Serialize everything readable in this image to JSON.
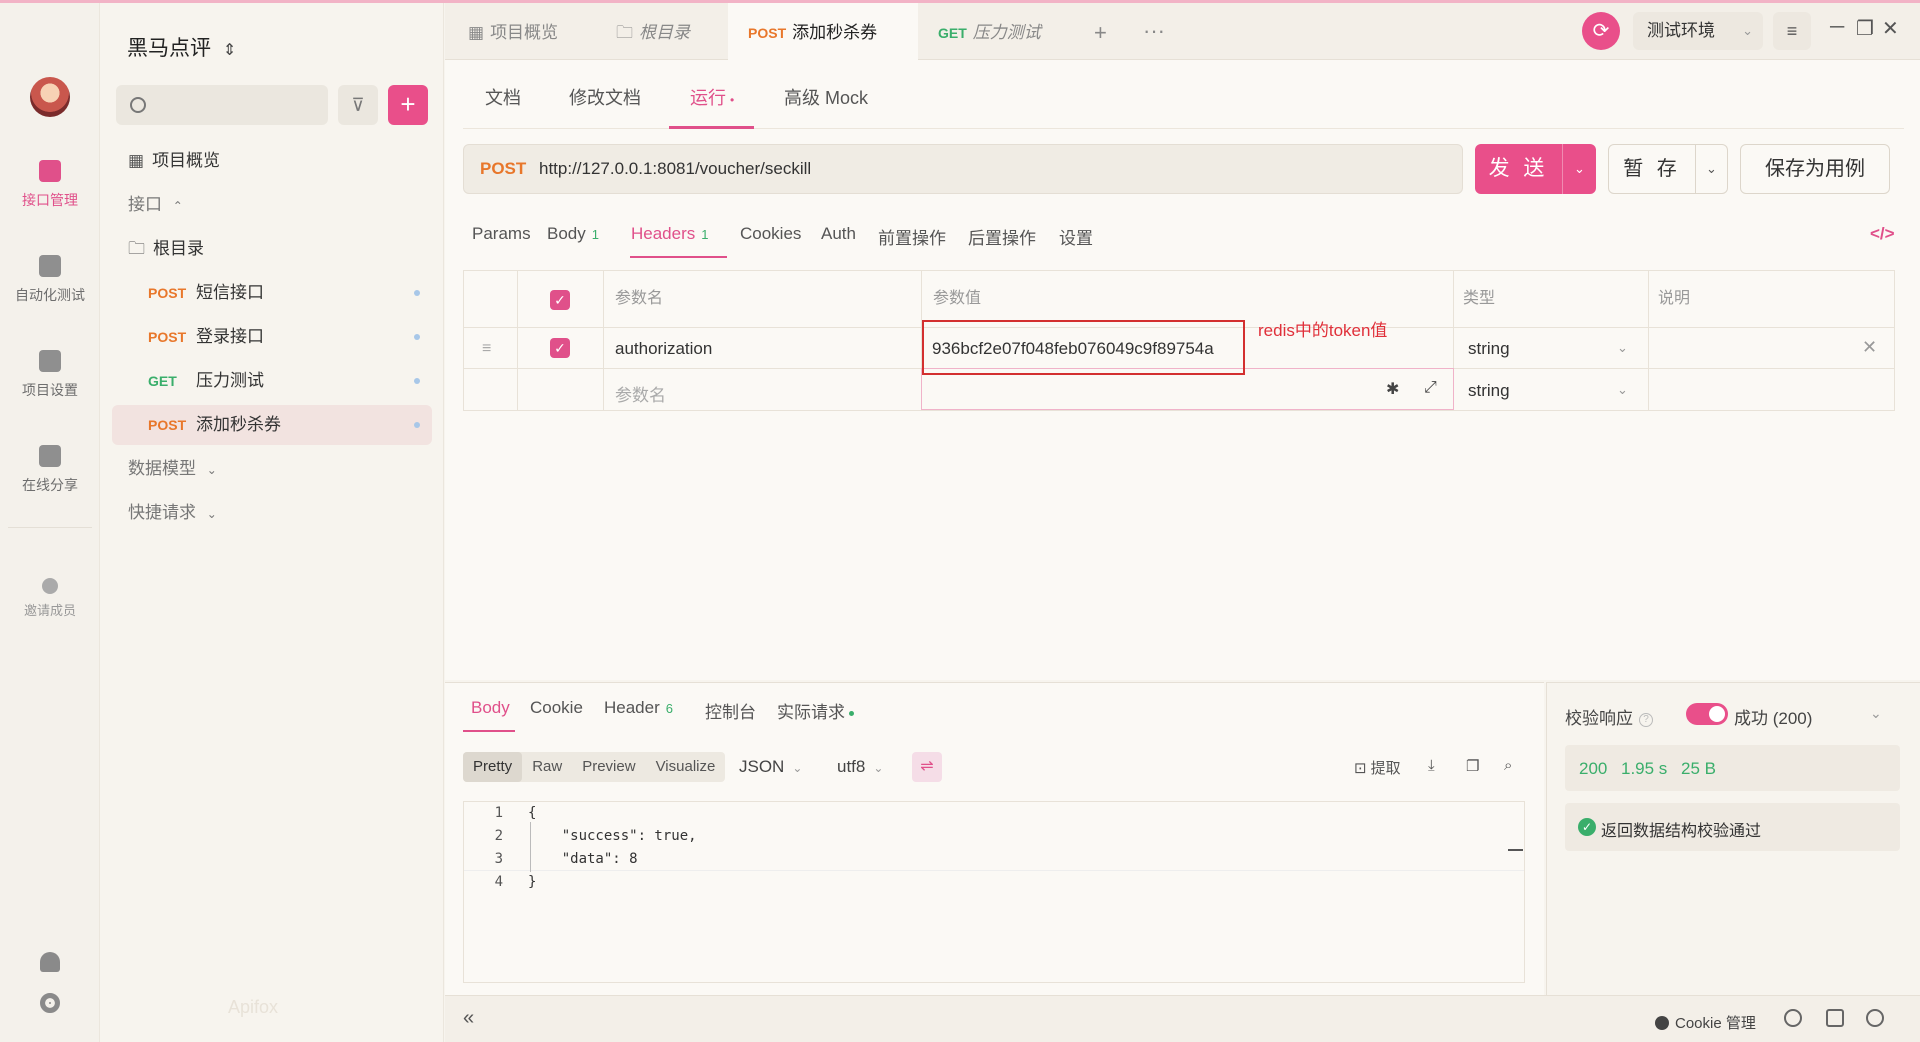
{
  "rail": {
    "items": [
      {
        "label": "接口管理",
        "icon": "api-icon"
      },
      {
        "label": "自动化测试",
        "icon": "automation-icon"
      },
      {
        "label": "项目设置",
        "icon": "settings-icon"
      },
      {
        "label": "在线分享",
        "icon": "share-icon"
      }
    ],
    "invite_label": "邀请成员"
  },
  "sidebar": {
    "project_name": "黑马点评",
    "project_switch_glyph": "⌃",
    "overview": "项目概览",
    "interfaces_label": "接口",
    "root_label": "根目录",
    "endpoints": [
      {
        "method": "POST",
        "name": "短信接口"
      },
      {
        "method": "POST",
        "name": "登录接口"
      },
      {
        "method": "GET",
        "name": "压力测试"
      },
      {
        "method": "POST",
        "name": "添加秒杀券"
      }
    ],
    "data_models": "数据模型",
    "quick_requests": "快捷请求",
    "watermark": "Apifox"
  },
  "tabs": [
    {
      "method": "",
      "label": "项目概览"
    },
    {
      "method": "",
      "label": "根目录"
    },
    {
      "method": "POST",
      "label": "添加秒杀券"
    },
    {
      "method": "GET",
      "label": "压力测试"
    }
  ],
  "env": {
    "selected": "测试环境"
  },
  "doc_tabs": [
    "文档",
    "修改文档",
    "运行",
    "高级 Mock"
  ],
  "request": {
    "method": "POST",
    "url": "http://127.0.0.1:8081/voucher/seckill",
    "send_label": "发 送",
    "save_label": "暂 存",
    "save_case_label": "保存为用例"
  },
  "req_tabs": [
    {
      "label": "Params",
      "count": ""
    },
    {
      "label": "Body",
      "count": "1"
    },
    {
      "label": "Headers",
      "count": "1"
    },
    {
      "label": "Cookies",
      "count": ""
    },
    {
      "label": "Auth",
      "count": ""
    },
    {
      "label": "前置操作",
      "count": ""
    },
    {
      "label": "后置操作",
      "count": ""
    },
    {
      "label": "设置",
      "count": ""
    }
  ],
  "headers_table": {
    "columns": [
      "参数名",
      "参数值",
      "类型",
      "说明"
    ],
    "rows": [
      {
        "name": "authorization",
        "value": "936bcf2e07f048feb076049c9f89754a",
        "type": "string"
      }
    ],
    "placeholder_name": "参数名",
    "placeholder_type": "string"
  },
  "annotation": "redis中的token值",
  "response": {
    "tabs": [
      {
        "label": "Body",
        "count": ""
      },
      {
        "label": "Cookie",
        "count": ""
      },
      {
        "label": "Header",
        "count": "6"
      },
      {
        "label": "控制台",
        "count": ""
      },
      {
        "label": "实际请求",
        "count": ""
      }
    ],
    "views": [
      "Pretty",
      "Raw",
      "Preview",
      "Visualize"
    ],
    "format": "JSON",
    "encoding": "utf8",
    "extract_label": "提取",
    "code_lines": [
      "{",
      "    \"success\": true,",
      "    \"data\": 8",
      "}"
    ]
  },
  "validation": {
    "label": "校验响应",
    "status": "成功 (200)",
    "code": "200",
    "time": "1.95 s",
    "size": "25 B",
    "message": "返回数据结构校验通过"
  },
  "footer": {
    "cookie_label": "Cookie 管理"
  },
  "colors": {
    "accent": "#e94f8a",
    "post": "#e8772b",
    "get": "#3aae6b",
    "annotation": "#d32f2f"
  }
}
